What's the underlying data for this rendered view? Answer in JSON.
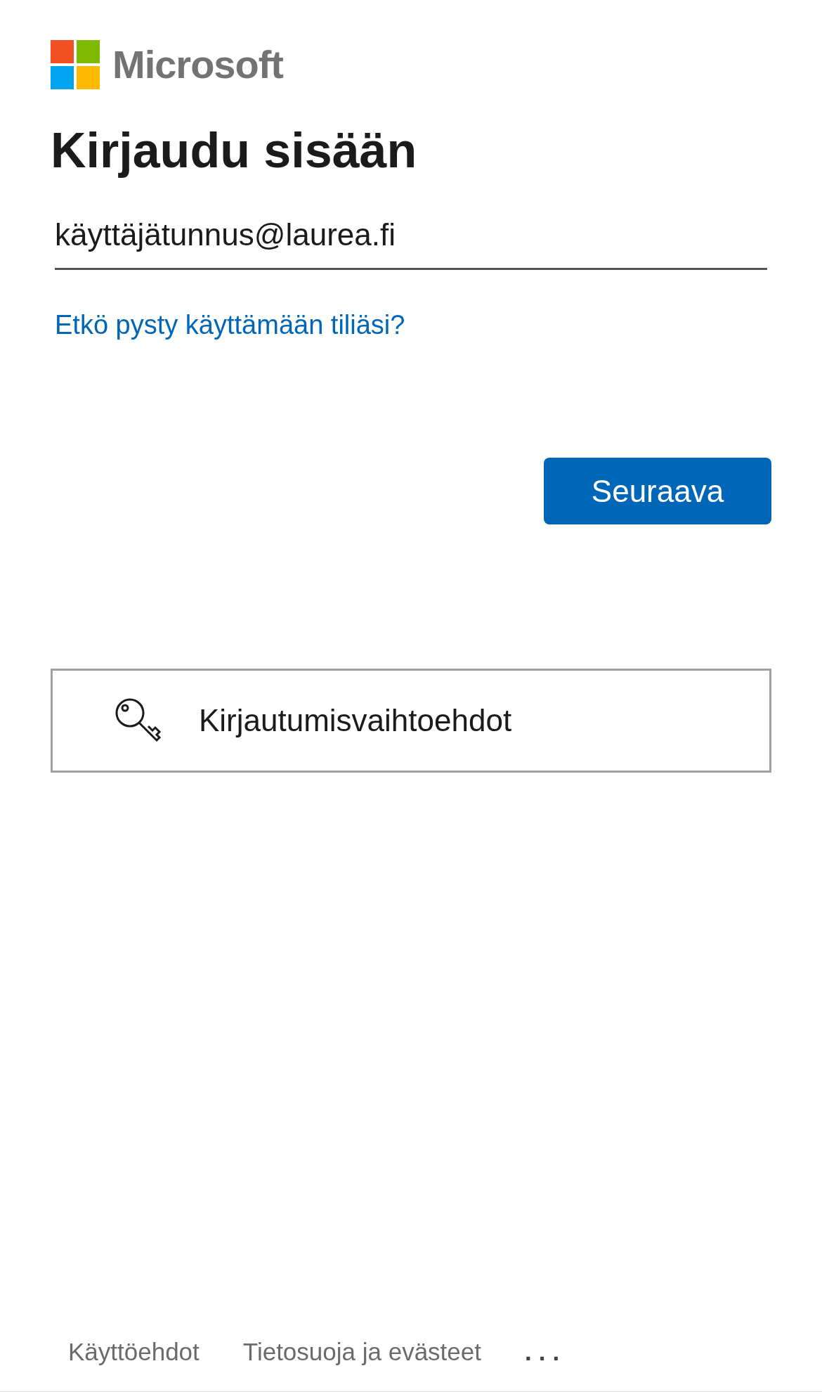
{
  "logo": {
    "text": "Microsoft"
  },
  "title": "Kirjaudu sisään",
  "email_field": {
    "value": "käyttäjätunnus@laurea.fi"
  },
  "help_link": "Etkö pysty käyttämään tiliäsi?",
  "next_button": "Seuraava",
  "signin_options_button": "Kirjautumisvaihtoehdot",
  "footer": {
    "links": [
      "Käyttöehdot",
      "Tietosuoja ja evästeet"
    ],
    "more": "..."
  }
}
